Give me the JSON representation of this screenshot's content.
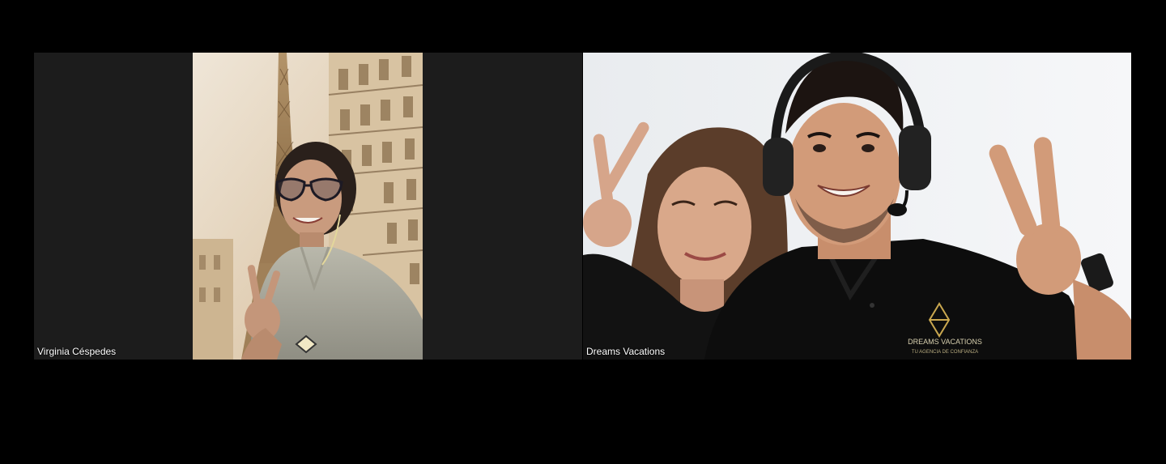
{
  "meeting": {
    "participants": [
      {
        "name": "Virginia Céspedes",
        "video_on": true
      },
      {
        "name": "Dreams Vacations",
        "video_on": true
      }
    ]
  },
  "logo": {
    "line1": "DREAMS VACATIONS",
    "line2": "TU AGENCIA DE CONFIANZA"
  },
  "colors": {
    "background": "#000000",
    "tile_bg": "#1c1c1c",
    "label_text": "#ffffff",
    "logo_gold": "#c9a74f"
  }
}
